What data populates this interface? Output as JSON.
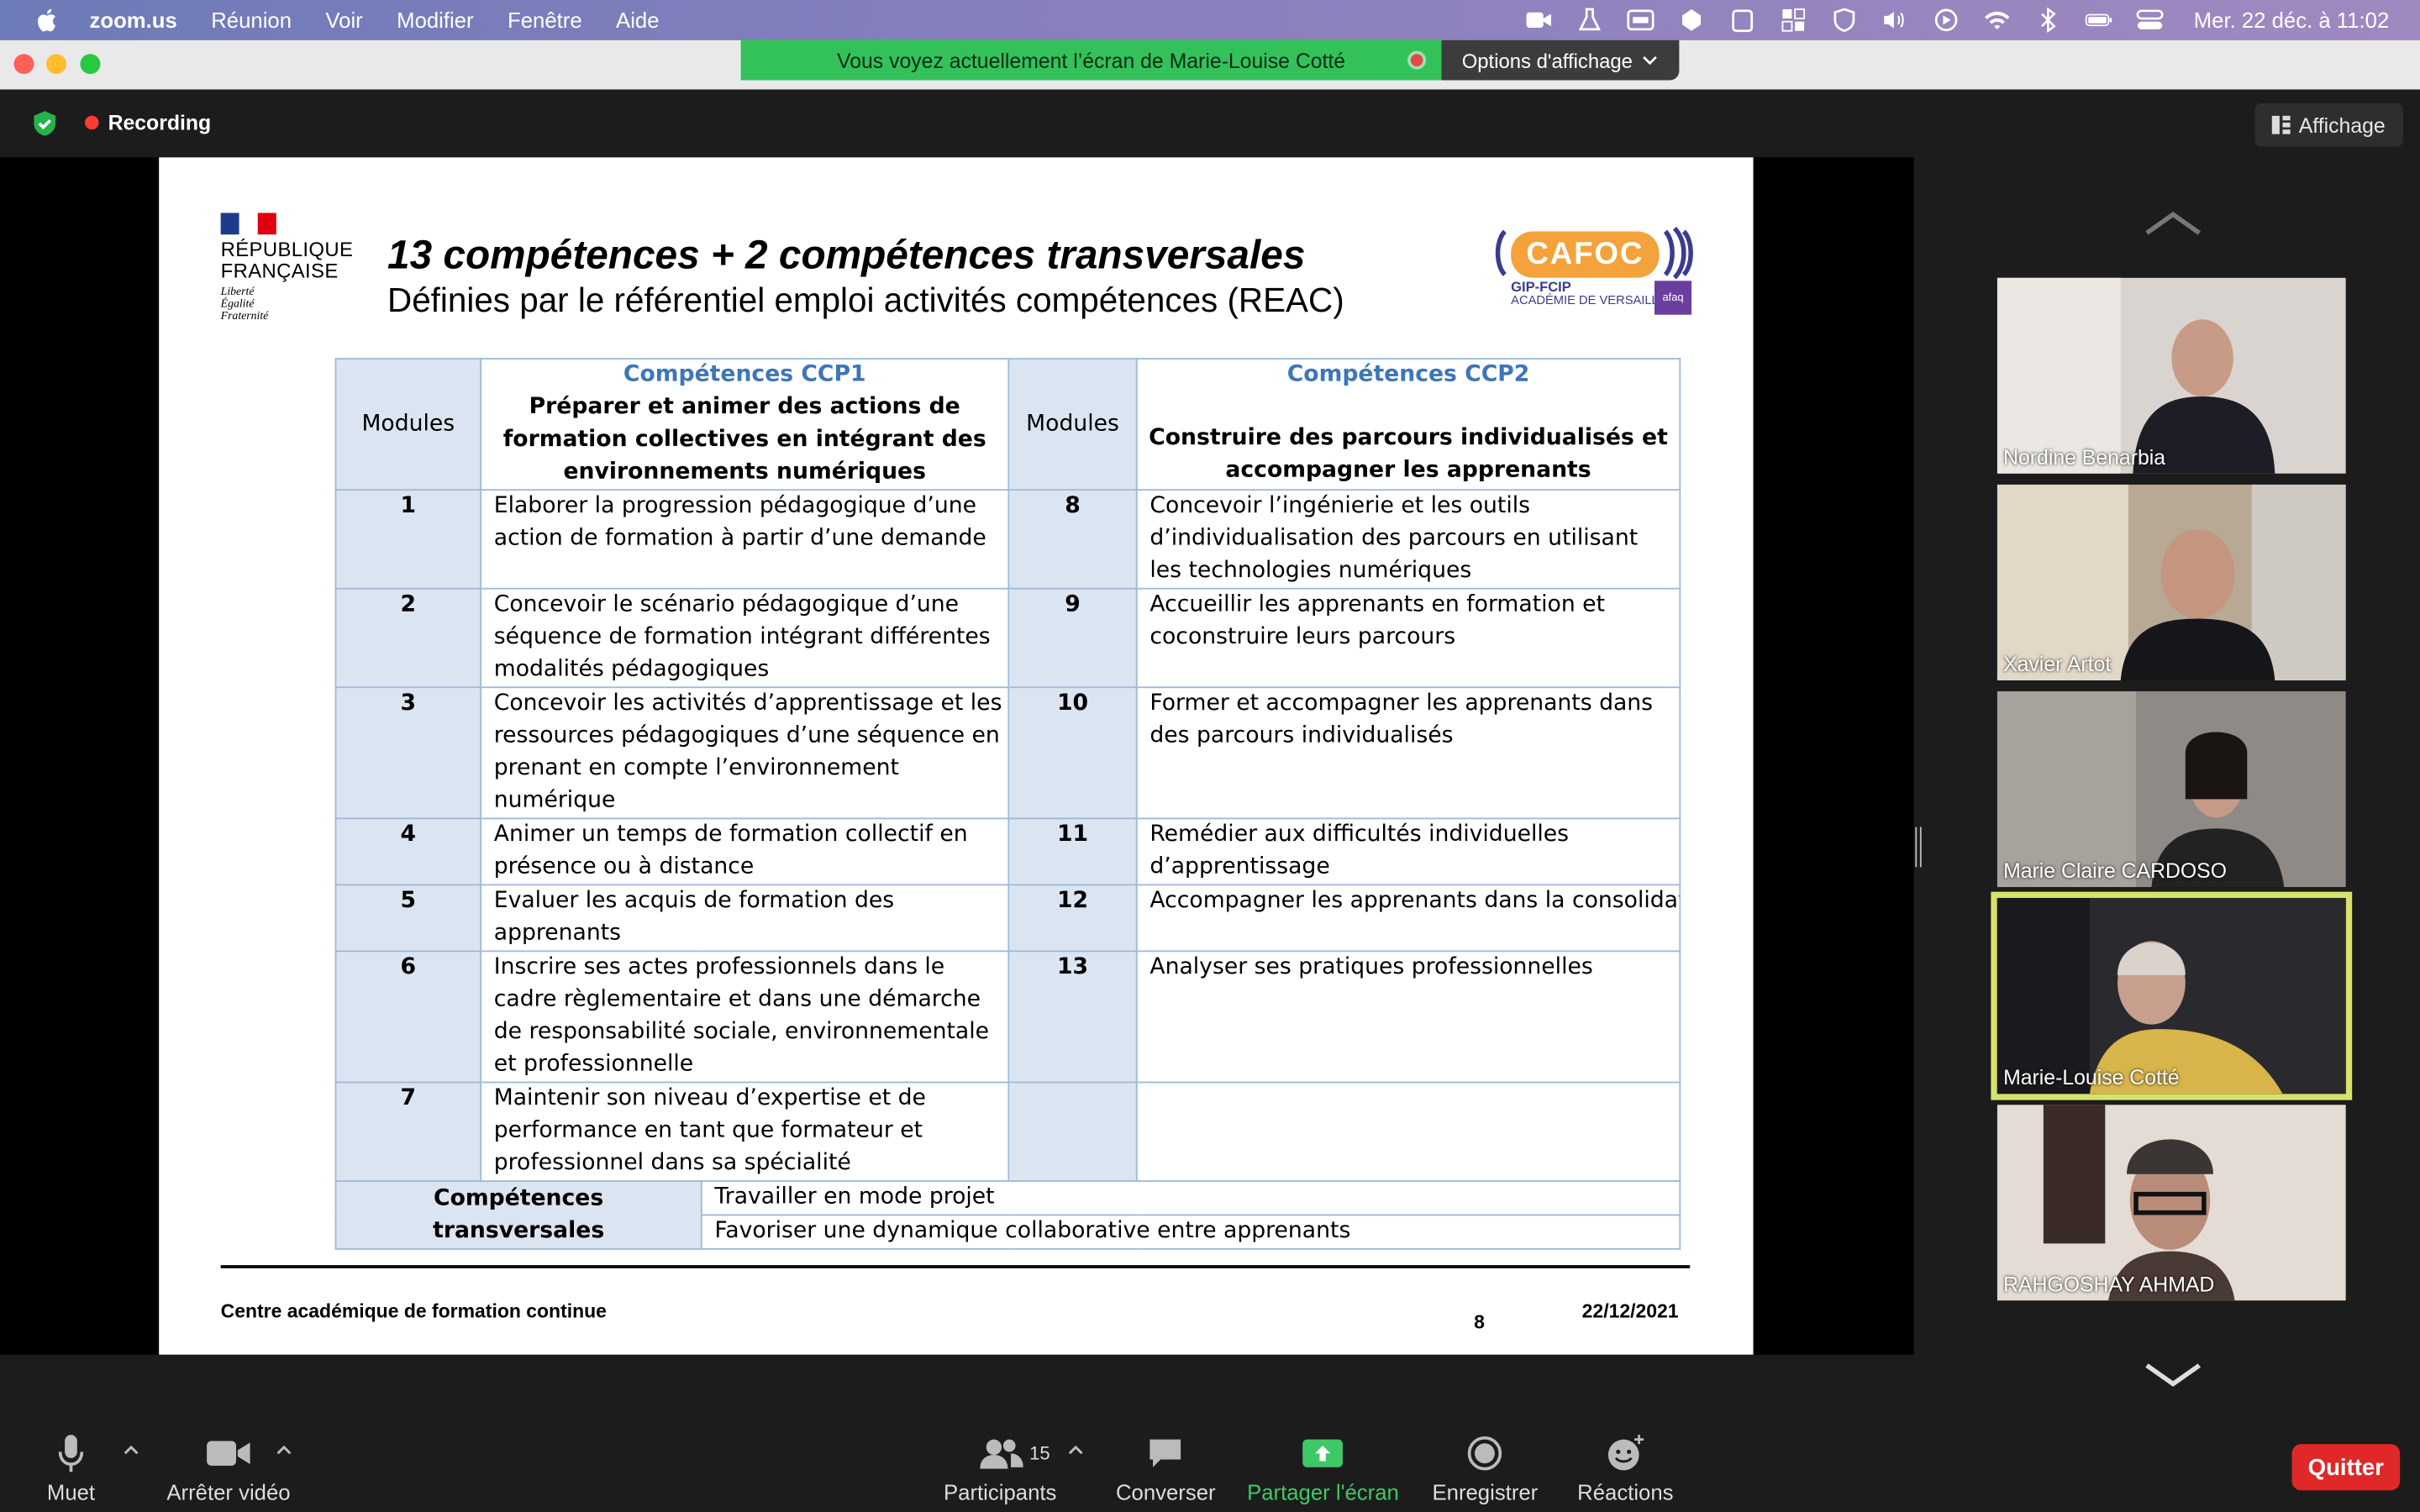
{
  "menubar": {
    "app": "zoom.us",
    "menus": [
      "Réunion",
      "Voir",
      "Modifier",
      "Fenêtre",
      "Aide"
    ],
    "clock": "Mer. 22 déc. à 11:02"
  },
  "share_banner": {
    "text": "Vous voyez actuellement l’écran de Marie-Louise Cotté",
    "options_label": "Options d'affichage"
  },
  "meeting": {
    "recording_label": "Recording",
    "display_label": "Affichage"
  },
  "slide": {
    "rf_name_1": "RÉPUBLIQUE",
    "rf_name_2": "FRANÇAISE",
    "rf_motto_1": "Liberté",
    "rf_motto_2": "Égalité",
    "rf_motto_3": "Fraternité",
    "title": "13 compétences + 2 compétences transversales",
    "subtitle": "Définies par le référentiel emploi activités compétences  (REAC)",
    "cafoc_word": "CAFOC",
    "cafoc_sub1": "GIP-FCIP",
    "cafoc_sub2": "ACADÉMIE DE VERSAILLES",
    "afaq": "afaq",
    "table": {
      "modules_label": "Modules",
      "ccp1_title": "Compétences CCP1",
      "ccp1_desc": "Préparer et animer des actions de formation collectives en intégrant des environnements numériques",
      "ccp2_title": "Compétences CCP2",
      "ccp2_desc": "Construire des parcours individualisés et accompagner les apprenants",
      "rows": [
        {
          "m1": "1",
          "c1": "Elaborer la progression pédagogique d’une action de formation à partir d’une demande",
          "m2": "8",
          "c2": "Concevoir l’ingénierie et les outils d’individualisation des parcours en utilisant les technologies numériques"
        },
        {
          "m1": "2",
          "c1": "Concevoir le scénario pédagogique d’une séquence de formation intégrant différentes modalités pédagogiques",
          "m2": "9",
          "c2": "Accueillir les apprenants en formation et coconstruire leurs parcours"
        },
        {
          "m1": "3",
          "c1": "Concevoir les activités d’apprentissage et les ressources pédagogiques d’une séquence en prenant en compte l’environnement numérique",
          "m2": "10",
          "c2": "Former et accompagner les apprenants dans des parcours individualisés"
        },
        {
          "m1": "4",
          "c1": "Animer un temps de formation collectif en présence ou à distance",
          "m2": "11",
          "c2": "Remédier aux difficultés individuelles d’apprentissage"
        },
        {
          "m1": "5",
          "c1": "Evaluer les acquis de formation des apprenants",
          "m2": "12",
          "c2": "Accompagner les apprenants dans la consolidation de leur projet professionne"
        },
        {
          "m1": "6",
          "c1": "Inscrire ses actes professionnels dans le cadre règlementaire et dans une démarche de responsabilité sociale, environnementale et professionnelle",
          "m2": "13",
          "c2": "Analyser ses pratiques professionnelles"
        },
        {
          "m1": "7",
          "c1": "Maintenir son niveau d’expertise et de performance en tant que formateur et professionnel dans sa spécialité",
          "m2": "",
          "c2": ""
        }
      ],
      "transversal_label": "Compétences transversales",
      "transversal_1": "Travailler en mode projet",
      "transversal_2": "Favoriser une dynamique collaborative entre apprenants"
    },
    "footer_org": "Centre académique de formation continue",
    "footer_page": "8",
    "footer_date": "22/12/2021"
  },
  "participants": [
    {
      "name": "Nordine Benarbia"
    },
    {
      "name": "Xavier Artot"
    },
    {
      "name": "Marie Claire CARDOSO"
    },
    {
      "name": "Marie-Louise Cotté",
      "active": true
    },
    {
      "name": "RAHGOSHAY  AHMAD"
    }
  ],
  "toolbar": {
    "mute": "Muet",
    "video": "Arrêter vidéo",
    "participants": "Participants",
    "participants_count": "15",
    "chat": "Converser",
    "share": "Partager l'écran",
    "record": "Enregistrer",
    "reactions": "Réactions",
    "leave": "Quitter"
  },
  "colors": {
    "share_green": "#33c25a",
    "table_header_blue": "#3e76b8",
    "module_cell_fill": "#dbe5f1",
    "active_speaker": "#d5e36b",
    "leave_red": "#e02828"
  }
}
